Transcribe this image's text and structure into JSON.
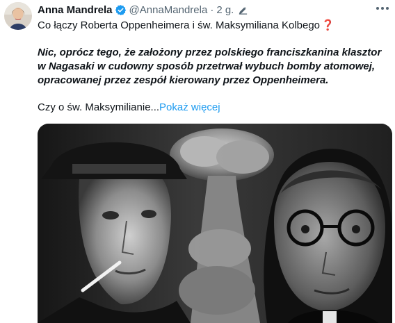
{
  "author": {
    "name": "Anna Mandrela",
    "handle": "@AnnaMandrela",
    "separator": "·",
    "time": "2 g.",
    "avatar_icon": "profile-photo",
    "verified_icon": "verified-badge-icon",
    "verified_color": "#1d9bf0"
  },
  "tweet": {
    "line1": "Co łączy Roberta Oppenheimera i św. Maksymiliana Kolbego",
    "line1_emoji": "❓",
    "bold_paragraph": "Nic, oprócz tego, że założony przez polskiego franciszkanina klasztor w Nagasaki w cudowny sposób przetrwał wybuch bomby atomowej, opracowanej przez zespół kierowany przez Oppenheimera.",
    "teaser": "Czy o św. Maksymilianie...",
    "show_more": "Pokaż więcej"
  },
  "media": {
    "image_icon": "collage-photo"
  },
  "colors": {
    "text": "#0f1419",
    "muted": "#536471",
    "link": "#1d9bf0",
    "emoji_red": "#d4202f"
  }
}
